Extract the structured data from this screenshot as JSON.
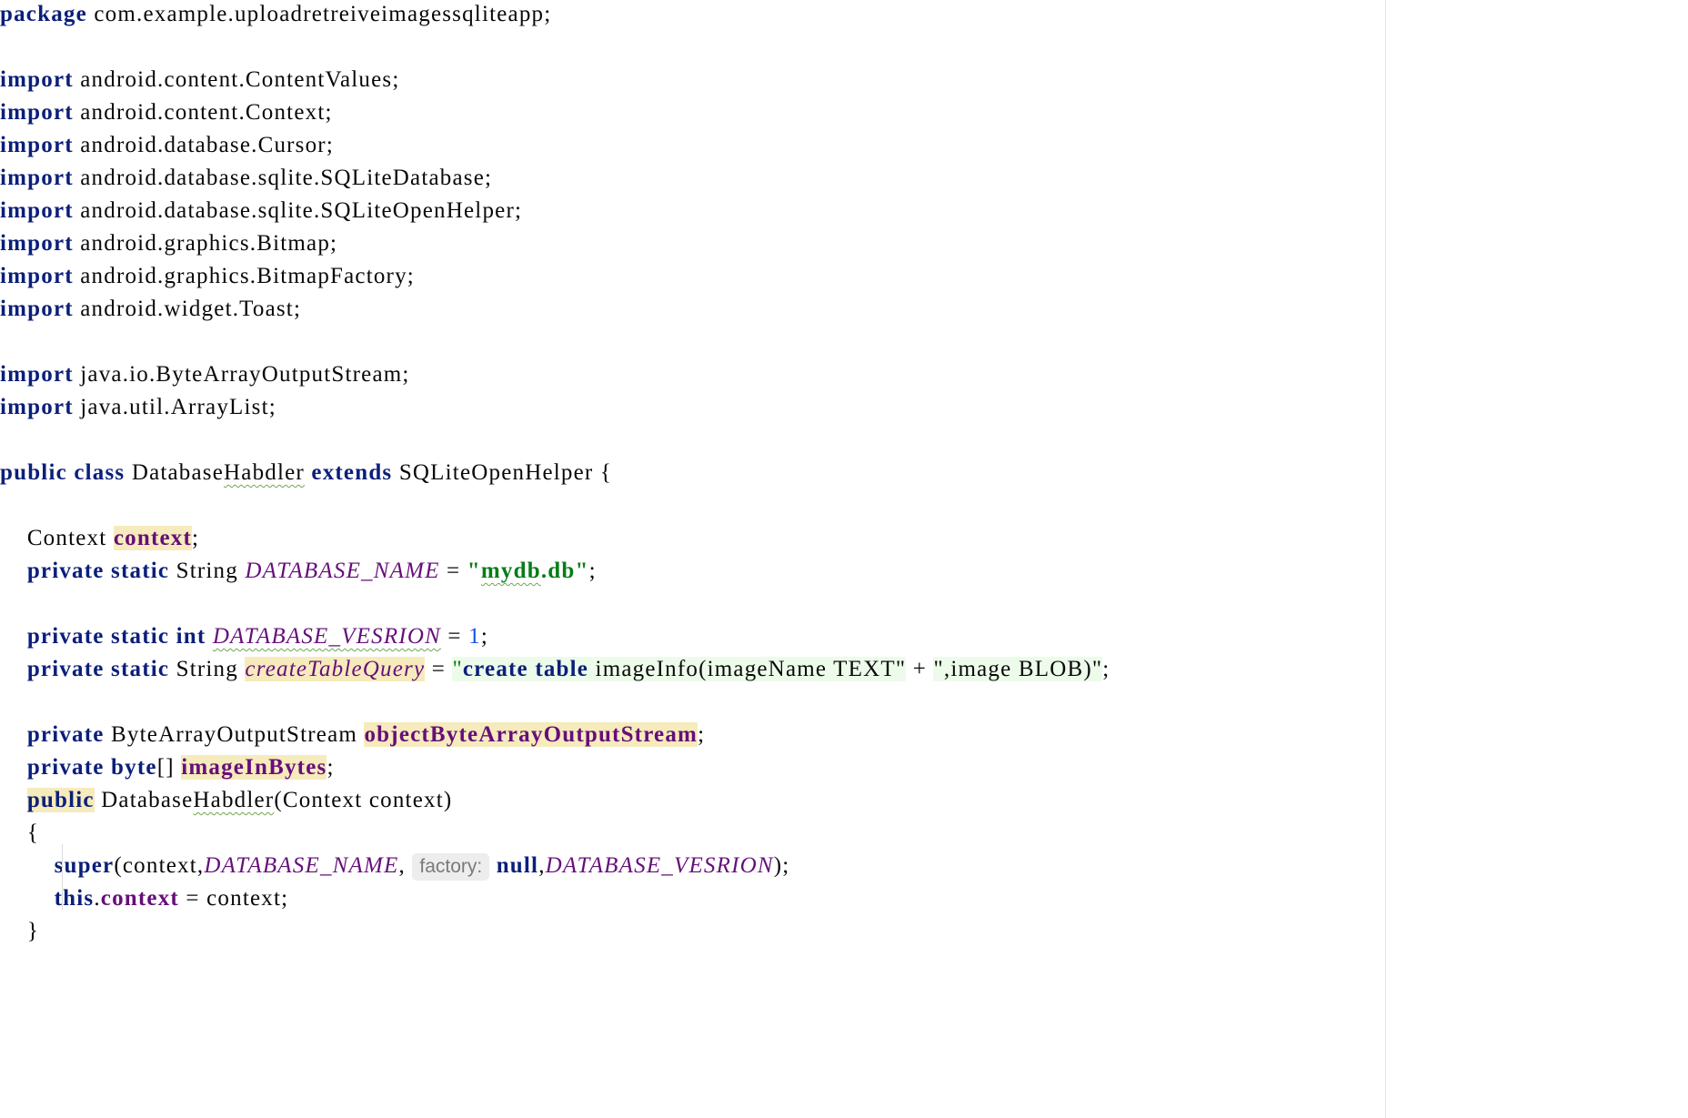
{
  "code": {
    "package_kw": "package",
    "package_name": "com.example.uploadretreiveimagessqliteapp;",
    "import_kw": "import",
    "imports": [
      "android.content.ContentValues;",
      "android.content.Context;",
      "android.database.Cursor;",
      "android.database.sqlite.SQLiteDatabase;",
      "android.database.sqlite.SQLiteOpenHelper;",
      "android.graphics.Bitmap;",
      "android.graphics.BitmapFactory;",
      "android.widget.Toast;",
      "java.io.ByteArrayOutputStream;",
      "java.util.ArrayList;"
    ],
    "kw_public": "public",
    "kw_class": "class",
    "kw_extends": "extends",
    "kw_private": "private",
    "kw_static": "static",
    "kw_int": "int",
    "kw_byte": "byte",
    "kw_super": "super",
    "kw_this": "this",
    "kw_null": "null",
    "class_name_prefix": "Database",
    "class_name_typo": "Habdler",
    "superclass": "SQLiteOpenHelper {",
    "type_context": "Context",
    "type_string": "String",
    "type_baos": "ByteArrayOutputStream",
    "field_context": "context",
    "db_name_const": "DATABASE_NAME",
    "db_version_const": "DATABASE_VESRION",
    "db_version_value": "1",
    "create_query_const": "createTableQuery",
    "str_open_quote": "\"",
    "str_db_typo": "mydb",
    "str_db_rest": ".db",
    "str_kw_create": "create",
    "str_kw_table": "table",
    "str_query_part1": " imageInfo(imageName TEXT\"",
    "str_query_part2": "\",image BLOB)\"",
    "field_baos": "objectByteArrayOutputStream",
    "field_image_bytes": "imageInBytes",
    "ctor_params": "(Context context)",
    "param_hint": "factory:",
    "brace_open": "{",
    "brace_close": "}",
    "assign_rhs": "context;"
  }
}
